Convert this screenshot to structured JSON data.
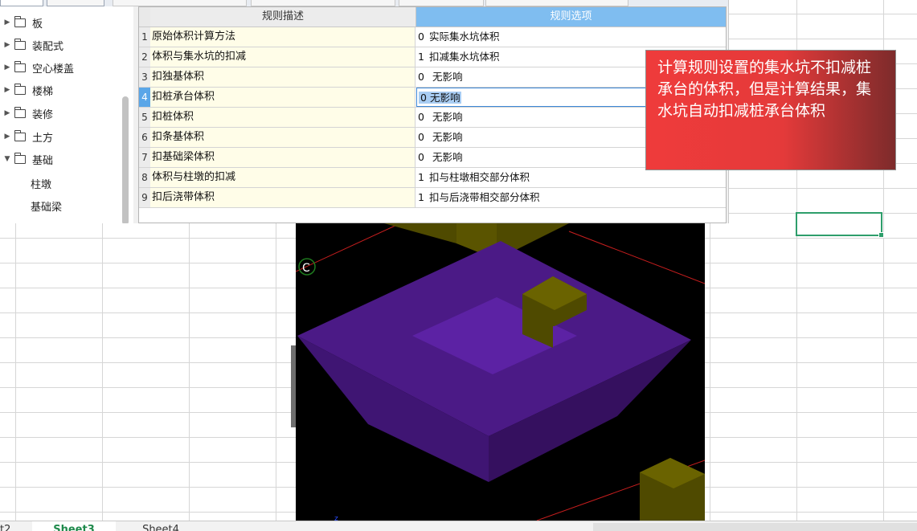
{
  "tree": {
    "items": [
      {
        "label": "板",
        "expanded": false
      },
      {
        "label": "装配式",
        "expanded": false
      },
      {
        "label": "空心楼盖",
        "expanded": false
      },
      {
        "label": "楼梯",
        "expanded": false
      },
      {
        "label": "装修",
        "expanded": false
      },
      {
        "label": "土方",
        "expanded": false
      },
      {
        "label": "基础",
        "expanded": true
      }
    ],
    "children": [
      "柱墩",
      "基础梁"
    ]
  },
  "rules_table": {
    "header_desc": "规则描述",
    "header_option": "规则选项",
    "rows": [
      {
        "num": "1",
        "desc": "原始体积计算方法",
        "code": "0",
        "option": "实际集水坑体积"
      },
      {
        "num": "2",
        "desc": "体积与集水坑的扣减",
        "code": "1",
        "option": "扣减集水坑体积"
      },
      {
        "num": "3",
        "desc": "扣独基体积",
        "code": "0",
        "option": "无影响"
      },
      {
        "num": "4",
        "desc": "扣桩承台体积",
        "code": "0",
        "option": "无影响",
        "editing": true
      },
      {
        "num": "5",
        "desc": "扣桩体积",
        "code": "0",
        "option": "无影响"
      },
      {
        "num": "6",
        "desc": "扣条基体积",
        "code": "0",
        "option": "无影响"
      },
      {
        "num": "7",
        "desc": "扣基础梁体积",
        "code": "0",
        "option": "无影响"
      },
      {
        "num": "8",
        "desc": "体积与柱墩的扣减",
        "code": "1",
        "option": "扣与柱墩相交部分体积"
      },
      {
        "num": "9",
        "desc": "扣后浇带体积",
        "code": "1",
        "option": "扣与后浇带相交部分体积"
      }
    ]
  },
  "annotation": {
    "text": "计算规则设置的集水坑不扣减桩承台的体积，但是计算结果，集水坑自动扣减桩承台体积"
  },
  "viewport": {
    "axis_label": "C",
    "colors": {
      "pit": "#4b1a86",
      "pit_inner": "#5c22a4",
      "cap": "#4f4a00",
      "cap_top": "#6a6300",
      "axis_line": "#c81e1e",
      "background": "#000000"
    }
  },
  "sheets": {
    "tabs": [
      {
        "label": "t2",
        "active": false
      },
      {
        "label": "Sheet3",
        "active": true
      },
      {
        "label": "Sheet4",
        "active": false
      }
    ]
  },
  "colors": {
    "selected_cell_border": "#2e9e6b",
    "option_header": "#7fbdf0"
  }
}
